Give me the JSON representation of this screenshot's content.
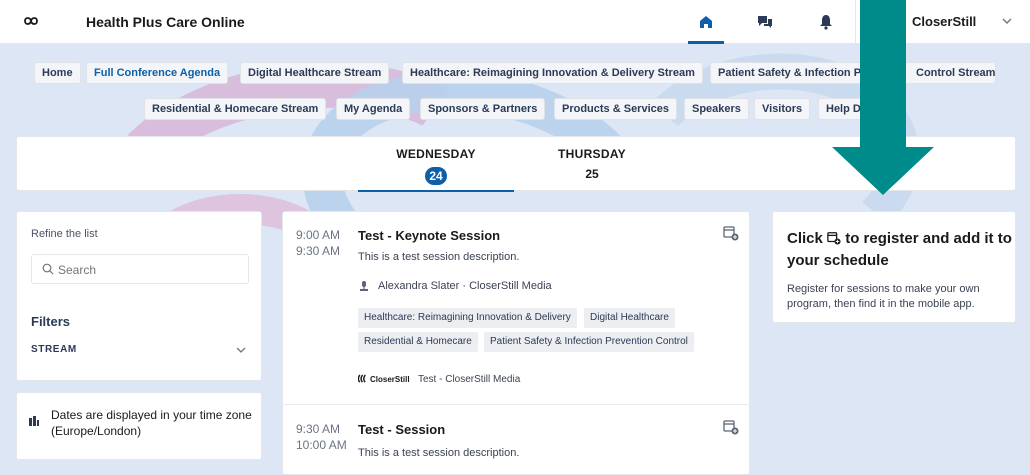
{
  "header": {
    "app_title": "Health Plus Care Online",
    "user_name": "CloserStill",
    "icons": [
      "infinity-logo",
      "home-icon",
      "chat-icon",
      "bell-icon",
      "chevron-down-icon"
    ]
  },
  "nav": {
    "row1": [
      "Home",
      "Full Conference Agenda",
      "Digital Healthcare Stream",
      "Healthcare: Reimagining Innovation & Delivery Stream",
      "Patient Safety & Infection Prevention Control Stream"
    ],
    "row1_visible": [
      "Home",
      "Full Conference Agenda",
      "Digital Healthcare Stream",
      "Healthcare: Reimagining Innovation & Delivery Stream",
      "Patient Safety & Infection Pre",
      "Control Stream"
    ],
    "row2": [
      "Residential & Homecare Stream",
      "My Agenda",
      "Sponsors & Partners",
      "Products & Services",
      "Speakers",
      "Visitors",
      "Help Des"
    ],
    "active": "Full Conference Agenda"
  },
  "days": [
    {
      "label": "WEDNESDAY",
      "number": "24",
      "selected": true
    },
    {
      "label": "THURSDAY",
      "number": "25",
      "selected": false
    }
  ],
  "filters": {
    "refine_title": "Refine the list",
    "search_placeholder": "Search",
    "filters_title": "Filters",
    "stream_label": "STREAM",
    "timezone_note": "Dates are displayed in your time zone (Europe/London)"
  },
  "sessions": [
    {
      "start": "9:00 AM",
      "end": "9:30 AM",
      "title": "Test - Keynote Session",
      "description": "This is a test session description.",
      "speaker": "Alexandra Slater · CloserStill Media",
      "tags": [
        "Healthcare: Reimagining Innovation & Delivery",
        "Digital Healthcare",
        "Residential & Homecare",
        "Patient Safety & Infection Prevention Control"
      ],
      "sponsor_logo": "CloserStill",
      "sponsor": "Test - CloserStill Media"
    },
    {
      "start": "9:30 AM",
      "end": "10:00 AM",
      "title": "Test - Session",
      "description": "This is a test session description."
    }
  ],
  "register": {
    "title_pre": "Click",
    "title_post": "to register and add it to your schedule",
    "description": "Register for sessions to make your own program, then find it in the mobile app."
  },
  "colors": {
    "brand": "#0d5fa8",
    "arrow": "#008b8b"
  }
}
